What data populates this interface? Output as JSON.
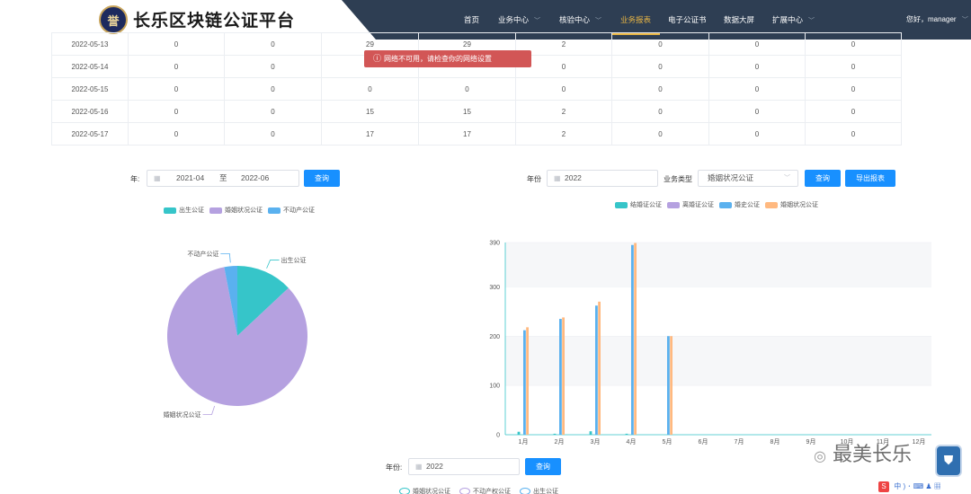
{
  "header": {
    "logo_glyph": "誉",
    "title": "长乐区块链公证平台",
    "nav": [
      {
        "label": "首页",
        "dropdown": false,
        "active": false
      },
      {
        "label": "业务中心",
        "dropdown": true,
        "active": false
      },
      {
        "label": "核验中心",
        "dropdown": true,
        "active": false
      },
      {
        "label": "业务报表",
        "dropdown": false,
        "active": true
      },
      {
        "label": "电子公证书",
        "dropdown": false,
        "active": false
      },
      {
        "label": "数据大屏",
        "dropdown": false,
        "active": false
      },
      {
        "label": "扩展中心",
        "dropdown": true,
        "active": false
      }
    ],
    "user": "您好，manager",
    "user_caret": "﹀",
    "colors": {
      "dark_bg": "#2e3e53",
      "active": "#e8b544"
    }
  },
  "table": {
    "rows": [
      [
        "2022-05-13",
        "0",
        "0",
        "29",
        "29",
        "2",
        "0",
        "0",
        "0"
      ],
      [
        "2022-05-14",
        "0",
        "0",
        "",
        "",
        "0",
        "0",
        "0",
        "0"
      ],
      [
        "2022-05-15",
        "0",
        "0",
        "0",
        "0",
        "0",
        "0",
        "0",
        "0"
      ],
      [
        "2022-05-16",
        "0",
        "0",
        "15",
        "15",
        "2",
        "0",
        "0",
        "0"
      ],
      [
        "2022-05-17",
        "0",
        "0",
        "17",
        "17",
        "2",
        "0",
        "0",
        "0"
      ]
    ]
  },
  "alert": {
    "icon": "ⓘ",
    "text": "网络不可用，请检查你的网络设置",
    "color": "#d25656"
  },
  "left_filter": {
    "year_label": "年:",
    "start": "2021-04",
    "separator": "至",
    "end": "2022-06",
    "query_label": "查询"
  },
  "right_filter": {
    "year_label": "年份",
    "year_value": "2022",
    "type_label": "业务类型",
    "type_value": "婚姻状况公证",
    "query_label": "查询",
    "export_label": "导出报表"
  },
  "bottom_filter": {
    "year_label": "年份:",
    "year_value": "2022",
    "query_label": "查询"
  },
  "bottom_legend": [
    "婚姻状况公证",
    "不动产权公证",
    "出生公证"
  ],
  "watermark": {
    "text": "最美长乐",
    "badge_glyph": "⛊",
    "tray_letter": "S",
    "tray_text": "中 ) ･ ⌨ ♟ ▦"
  },
  "chart_data": [
    {
      "type": "pie",
      "title": "",
      "legend_placement": "top",
      "slices": [
        {
          "name": "出生公证",
          "value": 13,
          "color": "#36c5c9"
        },
        {
          "name": "婚姻状况公证",
          "value": 84,
          "color": "#b5a1e0"
        },
        {
          "name": "不动产公证",
          "value": 3,
          "color": "#5ab1ef"
        }
      ]
    },
    {
      "type": "bar",
      "title": "",
      "legend_placement": "top",
      "categories": [
        "1月",
        "2月",
        "3月",
        "4月",
        "5月",
        "6月",
        "7月",
        "8月",
        "9月",
        "10月",
        "11月",
        "12月"
      ],
      "series": [
        {
          "name": "结婚证公证",
          "color": "#36c5c9",
          "values": [
            6,
            2,
            7,
            2,
            0,
            0,
            0,
            0,
            0,
            0,
            0,
            0
          ]
        },
        {
          "name": "离婚证公证",
          "color": "#b5a1e0",
          "values": [
            0,
            0,
            0,
            0,
            0,
            0,
            0,
            0,
            0,
            0,
            0,
            0
          ]
        },
        {
          "name": "婚史公证",
          "color": "#5ab1ef",
          "values": [
            212,
            235,
            262,
            385,
            200,
            0,
            0,
            0,
            0,
            0,
            0,
            0
          ]
        },
        {
          "name": "婚姻状况公证",
          "color": "#ffb980",
          "values": [
            218,
            238,
            270,
            389,
            200,
            0,
            0,
            0,
            0,
            0,
            0,
            0
          ]
        }
      ],
      "ylim": [
        0,
        390
      ],
      "yticks": [
        0,
        100,
        200,
        300,
        390
      ],
      "grid": true
    }
  ]
}
